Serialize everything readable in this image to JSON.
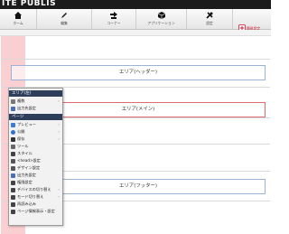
{
  "header": {
    "brand": "ITE PUBLIS",
    "notice_label": "簡易設定"
  },
  "toolbar": {
    "items": [
      {
        "label": "ホーム",
        "icon": "home-icon"
      },
      {
        "label": "編集",
        "icon": "pencil-icon"
      },
      {
        "label": "コーナー",
        "icon": "corner-icon"
      },
      {
        "label": "アプリケーション",
        "icon": "cube-icon"
      },
      {
        "label": "設定",
        "icon": "wrench-icon"
      }
    ]
  },
  "areas": {
    "header": "エリア(ヘッダー)",
    "main": "エリア(メイン)",
    "footer": "エリア(フッター)"
  },
  "context_menu": {
    "section_area": "エリア(左)",
    "area_items": [
      {
        "label": "複数",
        "icon": "layers-icon",
        "color": "#777777",
        "submenu": true
      },
      {
        "label": "出力先設定",
        "icon": "output-icon",
        "color": "#4a6fb5",
        "submenu": false
      }
    ],
    "section_page": "ページ",
    "page_items": [
      {
        "label": "プレビュー",
        "icon": "preview-icon",
        "color": "#3a7bd5",
        "submenu": true
      },
      {
        "label": "公開",
        "icon": "globe-icon",
        "color": "#2f6fd0",
        "submenu": true
      },
      {
        "label": "保存",
        "icon": "save-icon",
        "color": "#333333",
        "submenu": true
      },
      {
        "label": "ツール",
        "icon": "tool-icon",
        "color": "#666666",
        "submenu": false
      },
      {
        "label": "スタイル",
        "icon": "style-icon",
        "color": "#444444",
        "submenu": false
      },
      {
        "label": "<head>設定",
        "icon": "head-icon",
        "color": "#555555",
        "submenu": false
      },
      {
        "label": "デザイン設定",
        "icon": "design-icon",
        "color": "#555555",
        "submenu": false
      },
      {
        "label": "出力先設定",
        "icon": "output-icon",
        "color": "#4a6fb5",
        "submenu": false
      },
      {
        "label": "権限設定",
        "icon": "permission-icon",
        "color": "#444444",
        "submenu": false
      },
      {
        "label": "デバイスの切り替え",
        "icon": "device-icon",
        "color": "#444444",
        "submenu": true
      },
      {
        "label": "モード切り替え",
        "icon": "mode-icon",
        "color": "#444444",
        "submenu": true
      },
      {
        "label": "再読み込み",
        "icon": "reload-icon",
        "color": "#444444",
        "submenu": false
      },
      {
        "label": "ページ情報表示・設定",
        "icon": "info-icon",
        "color": "#444444",
        "submenu": false
      }
    ]
  },
  "colors": {
    "menu_header": "#2d3d5a",
    "pink_overlay": "#f9c7c9",
    "area_border": "#9bb3d8",
    "area_selected_border": "#e06d6d"
  }
}
